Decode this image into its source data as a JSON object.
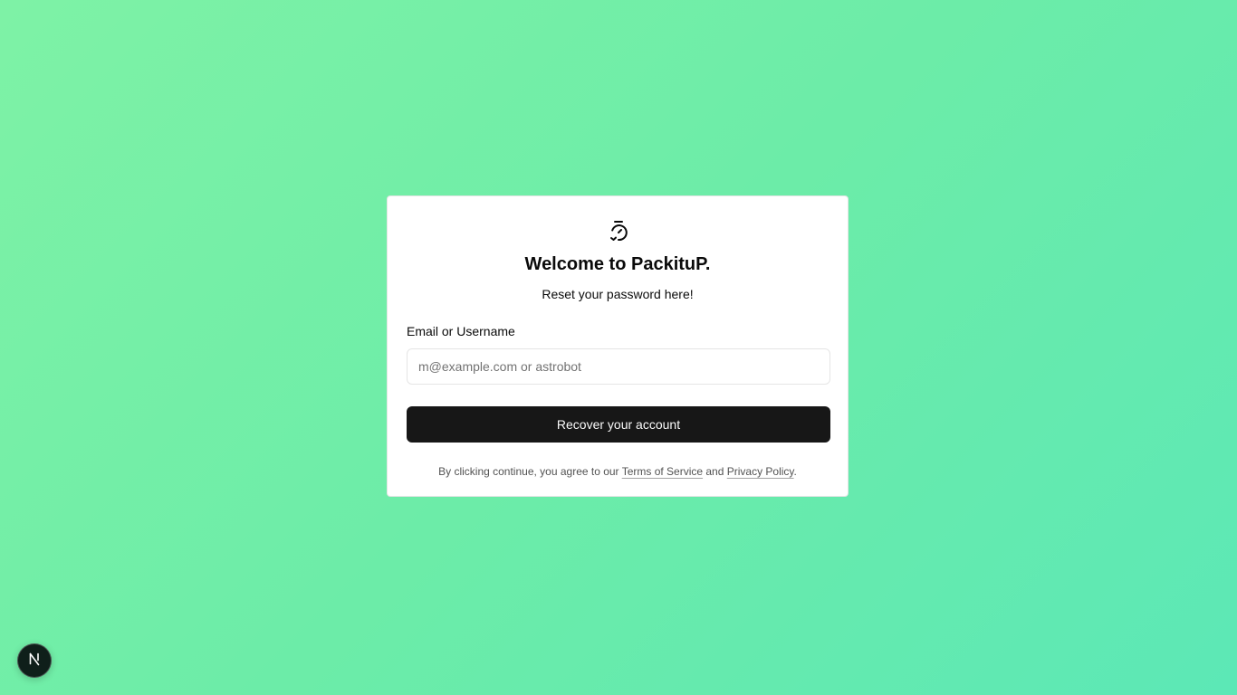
{
  "card": {
    "logo_icon": "timer-reset-icon",
    "title": "Welcome to PackituP.",
    "subtitle": "Reset your password here!",
    "field": {
      "label": "Email or Username",
      "value": "",
      "placeholder": "m@example.com or astrobot"
    },
    "submit_label": "Recover your account",
    "legal": {
      "prefix": "By clicking continue, you agree to our ",
      "terms": "Terms of Service",
      "middle": " and ",
      "privacy": "Privacy Policy",
      "suffix": "."
    }
  },
  "badge": {
    "icon": "nextjs-icon"
  },
  "colors": {
    "background_start": "#7ef2a6",
    "background_end": "#5ce8b6",
    "button": "#171717",
    "card": "#ffffff"
  }
}
